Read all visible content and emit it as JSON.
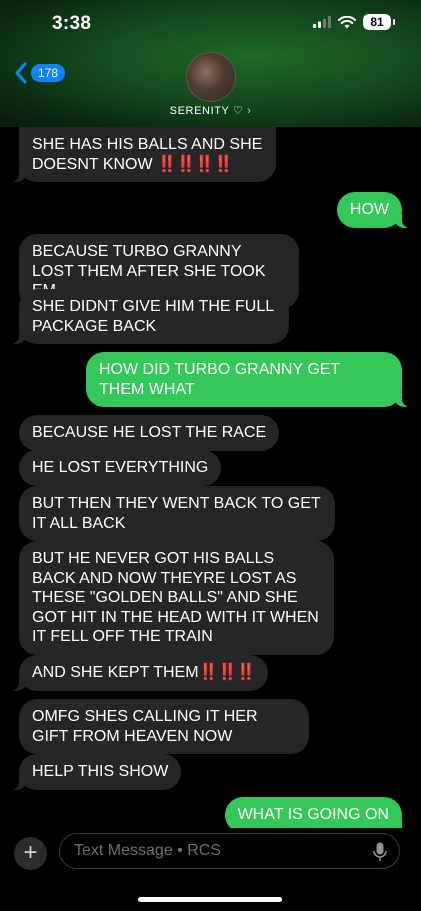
{
  "status": {
    "time": "3:38",
    "battery": "81"
  },
  "header": {
    "back_count": "178",
    "contact": "SERENITY ♡",
    "chevron": "›"
  },
  "messages": [
    {
      "dir": "in",
      "text": "SHE HAS HIS BALLS AND SHE DOESNT KNOW ",
      "bangs": "‼️‼️‼️‼️"
    },
    {
      "dir": "out",
      "text": "HOW"
    },
    {
      "dir": "in",
      "text": "BECAUSE TURBO GRANNY LOST THEM AFTER SHE TOOK EM"
    },
    {
      "dir": "in",
      "text": "SHE DIDNT GIVE HIM THE FULL PACKAGE BACK"
    },
    {
      "dir": "out",
      "text": "HOW DID TURBO GRANNY GET THEM WHAT"
    },
    {
      "dir": "in",
      "text": "BECAUSE HE LOST THE RACE"
    },
    {
      "dir": "in",
      "text": "HE LOST EVERYTHING"
    },
    {
      "dir": "in",
      "text": "BUT THEN THEY WENT BACK TO GET IT ALL BACK"
    },
    {
      "dir": "in",
      "text": "BUT HE NEVER GOT HIS BALLS BACK AND NOW THEYRE LOST AS THESE \"GOLDEN BALLS\" AND SHE GOT HIT IN THE HEAD WITH IT WHEN IT FELL OFF THE TRAIN"
    },
    {
      "dir": "in",
      "text": "AND SHE KEPT THEM",
      "bangs": "‼️‼️‼️"
    },
    {
      "dir": "in",
      "text": "OMFG SHES CALLING IT HER GIFT FROM HEAVEN NOW"
    },
    {
      "dir": "in",
      "text": "HELP THIS SHOW"
    },
    {
      "dir": "out",
      "text": "WHAT IS GOING ON"
    }
  ],
  "input": {
    "placeholder": "Text Message • RCS"
  },
  "icons": {
    "plus": "plus-icon",
    "mic": "microphone-icon",
    "back": "chevron-left-icon"
  },
  "colors": {
    "incoming": "#262628",
    "outgoing": "#34c759",
    "accent": "#0a84ff"
  }
}
